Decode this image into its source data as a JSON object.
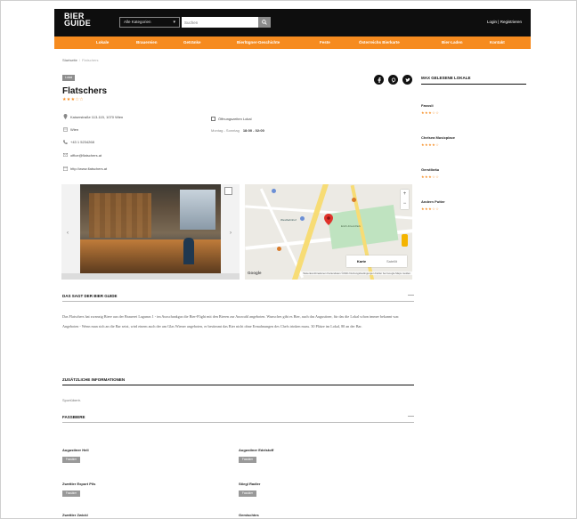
{
  "header": {
    "logo_line1": "BIER",
    "logo_line2": "GUIDE",
    "category_select": "Alle Kategorien",
    "search_placeholder": "Suchen",
    "login_text": "Login | Registrieren"
  },
  "nav": {
    "items": [
      "Lokale",
      "Brauereien",
      "Getränke",
      "Bierlügner-Geschichte",
      "Feste",
      "Österreichs Bierkarte",
      "Bier-Laden",
      "Kontakt"
    ]
  },
  "breadcrumb": {
    "home": "Startseite",
    "current": "Flatschers"
  },
  "venue": {
    "tag": "Lokal",
    "title": "Flatschers",
    "rating": 3,
    "stars_text": "★★★☆☆",
    "address": "Kaiserstraße 113-115, 1070 Wien",
    "region": "Wien",
    "phone": "+43 1 5234268",
    "email": "office@flatschers.at",
    "website": "http://www.flatschers.at",
    "hours_label": "Öffnungszeiten Lokal",
    "hours_day": "Montag - Sonntag",
    "hours_time": "18:00 - 02:00"
  },
  "map": {
    "type_map": "Karte",
    "type_sat": "Satellit",
    "google": "Google",
    "attribution": "Tastenkombinationen  Kartendaten ©2021  Nutzungsbedingungen  Fehler bei Google Maps melden",
    "label_park": "Erich-Fried-Park",
    "label_station": "Westbahnhof"
  },
  "sections": {
    "guide_title": "DAS SAGT DER BIER GUIDE",
    "guide_text": "Das Flatschers hat zwanzig Biere aus der Brauerei Lagunas 1 - im Ausschankgas die Bier-Flight mit den Bieren zur Auswahl angeboten. Wunsches gibt es Bier, auch das Augustiner, für das die Lokal schon immer bekannt war. Angeboten - Wenn man sich an die Bar setzt, wird einem auch der am Glas Wiener angeboten, er bestimmt das Bier nicht ohne Ermahnungen des Chefs trinken muss. 30 Plätze im Lokal, 80 an der Bar.",
    "extra_title": "ZUSÄTZLICHE INFORMATIONEN",
    "extra_value": "Sportübertr.",
    "beers_title": "FASSBIERE"
  },
  "beers": [
    {
      "name": "Augustiner Hell",
      "tag": "Fassbier"
    },
    {
      "name": "Augustiner Edelstoff",
      "tag": "Fassbier"
    },
    {
      "name": "Zwettler Export Pils",
      "tag": "Fassbier"
    },
    {
      "name": "Stiegl Radler",
      "tag": "Fassbier"
    },
    {
      "name": "Zwettler Zwickl",
      "tag": ""
    },
    {
      "name": "Gemischtes",
      "tag": ""
    }
  ],
  "sidebar": {
    "title": "MAX GELESENE LOKALE",
    "items": [
      {
        "name": "Fasssli",
        "stars": "★★★☆☆"
      },
      {
        "name": "Chelsea Musicplace",
        "stars": "★★★★☆"
      },
      {
        "name": "Gerstlbräu",
        "stars": "★★★☆☆"
      },
      {
        "name": "Andern Putter",
        "stars": "★★★☆☆"
      }
    ]
  },
  "colors": {
    "accent": "#f68b1f",
    "topbar": "#0e0e0e"
  }
}
